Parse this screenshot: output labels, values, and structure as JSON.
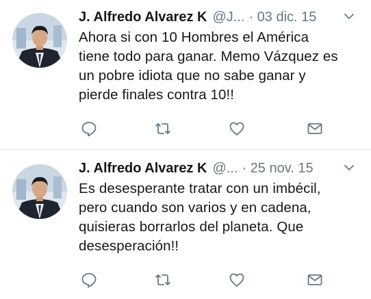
{
  "tweets": [
    {
      "author_name": "J. Alfredo Alvarez K",
      "handle": "@J...",
      "timestamp": "· 03 dic. 15",
      "text": "Ahora si con 10 Hombres el América\ntiene todo para ganar. Memo Vázquez es\nun pobre idiota que no sabe ganar y\npierde finales contra 10!!"
    },
    {
      "author_name": "J. Alfredo Alvarez K",
      "handle": "@...",
      "timestamp": "· 25 nov. 15",
      "text": "Es desesperante tratar con un imbécil,\npero cuando son varios y en cadena,\nquisieras borrarlos del planeta. Que\ndesesperación!!"
    }
  ],
  "icons": {
    "reply": "reply-icon",
    "retweet": "retweet-icon",
    "like": "heart-icon",
    "dm": "envelope-icon",
    "more": "chevron-down-icon"
  },
  "colors": {
    "name": "#14171a",
    "secondary": "#657786",
    "divider": "#e1e8ed"
  }
}
